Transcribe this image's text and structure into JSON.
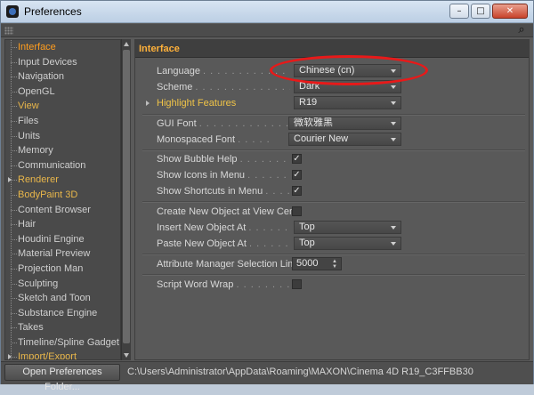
{
  "window": {
    "title": "Preferences",
    "minimize": "–",
    "restore": "□",
    "close": "✕"
  },
  "icons": {
    "search": "⌕"
  },
  "sidebar": {
    "items": [
      {
        "label": "Interface",
        "selected": true
      },
      {
        "label": "Input Devices"
      },
      {
        "label": "Navigation"
      },
      {
        "label": "OpenGL"
      },
      {
        "label": "View",
        "bold": true
      },
      {
        "label": "Files"
      },
      {
        "label": "Units"
      },
      {
        "label": "Memory"
      },
      {
        "label": "Communication"
      },
      {
        "label": "Renderer",
        "bold": true,
        "expandable": true
      },
      {
        "label": "BodyPaint 3D",
        "bold": true
      },
      {
        "label": "Content Browser"
      },
      {
        "label": "Hair"
      },
      {
        "label": "Houdini Engine"
      },
      {
        "label": "Material Preview"
      },
      {
        "label": "Projection Man"
      },
      {
        "label": "Sculpting"
      },
      {
        "label": "Sketch and Toon"
      },
      {
        "label": "Substance Engine"
      },
      {
        "label": "Takes"
      },
      {
        "label": "Timeline/Spline Gadget"
      },
      {
        "label": "Import/Export",
        "bold": true,
        "expandable": true
      }
    ]
  },
  "panel": {
    "header": "Interface",
    "language": {
      "label": "Language",
      "value": "Chinese (cn)"
    },
    "scheme": {
      "label": "Scheme",
      "value": "Dark"
    },
    "highlight": {
      "label": "Highlight Features",
      "value": "R19"
    },
    "gui_font": {
      "label": "GUI Font",
      "value": "微软雅黑"
    },
    "mono_font": {
      "label": "Monospaced Font",
      "value": "Courier New"
    },
    "bubble_help": {
      "label": "Show Bubble Help",
      "checked": "✓"
    },
    "icons_menu": {
      "label": "Show Icons in Menu",
      "checked": "✓"
    },
    "shortcuts_menu": {
      "label": "Show Shortcuts in Menu",
      "checked": "✓"
    },
    "create_center": {
      "label": "Create New Object at View Center",
      "checked": ""
    },
    "insert_at": {
      "label": "Insert New Object At",
      "value": "Top"
    },
    "paste_at": {
      "label": "Paste New Object At",
      "value": "Top"
    },
    "attr_limit": {
      "label": "Attribute Manager Selection Limit",
      "value": "5000"
    },
    "word_wrap": {
      "label": "Script Word Wrap",
      "checked": ""
    }
  },
  "footer": {
    "open_button": "Open Preferences Folder...",
    "path": "C:\\Users\\Administrator\\AppData\\Roaming\\MAXON\\Cinema 4D R19_C3FFBB30"
  },
  "colors": {
    "accent_selected": "#ff9d1e",
    "accent_bold": "#f0c448",
    "annotation": "#e81919"
  }
}
